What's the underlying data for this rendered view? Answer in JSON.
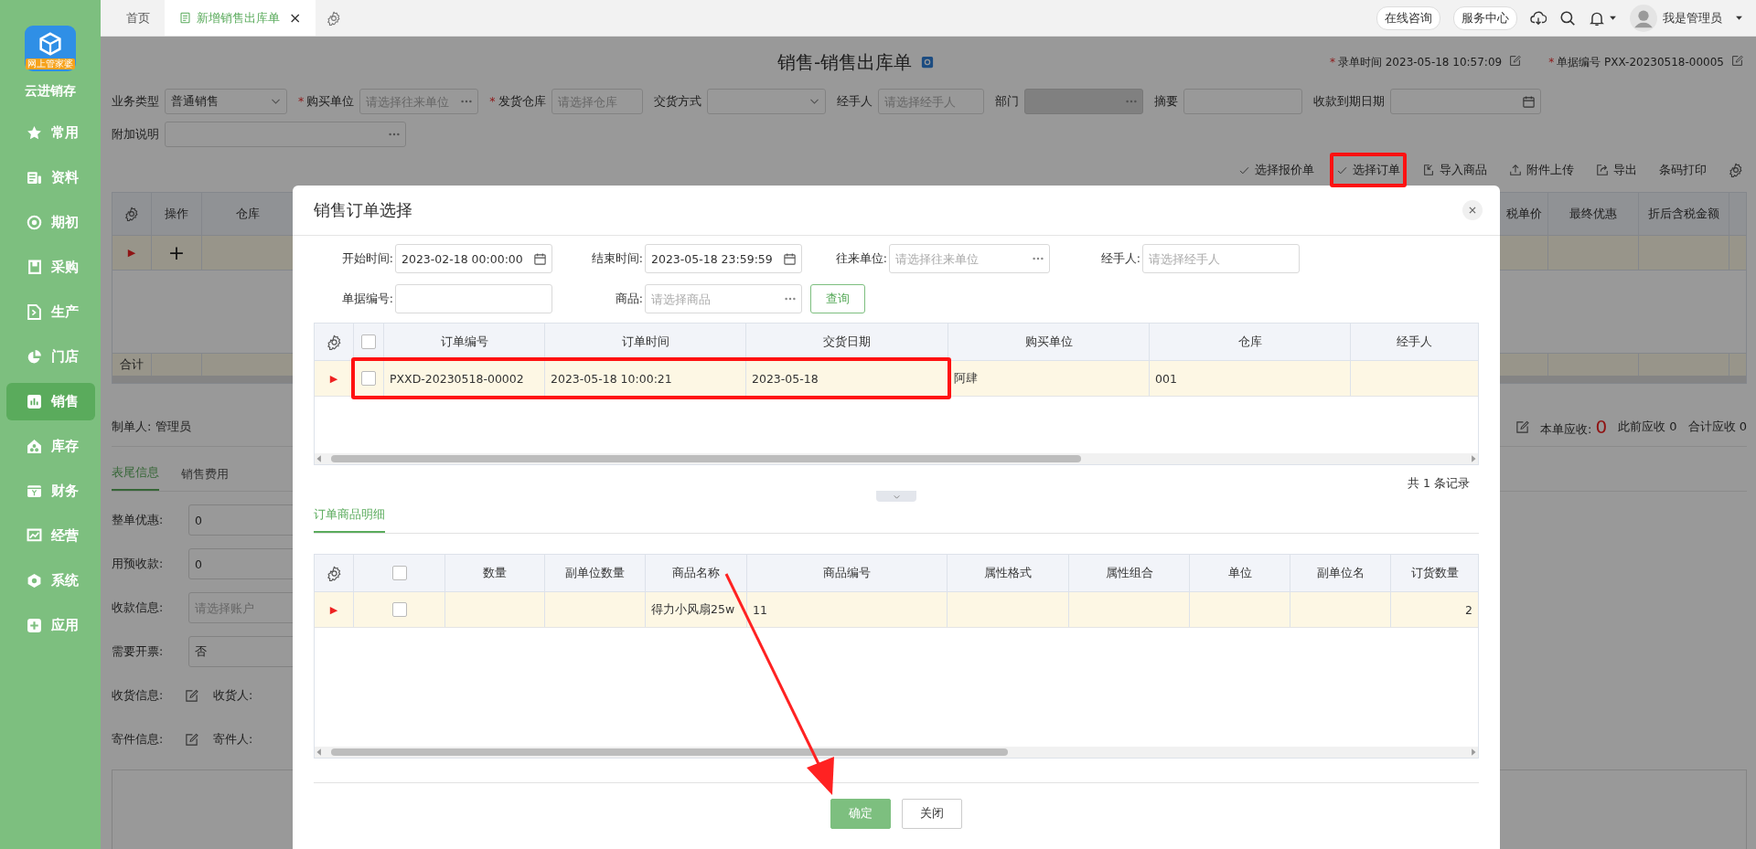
{
  "sidebar": {
    "logo_badge": "网上管家婆",
    "app_name": "云进销存",
    "items": [
      {
        "label": "常用",
        "selected": false
      },
      {
        "label": "资料",
        "selected": false
      },
      {
        "label": "期初",
        "selected": false
      },
      {
        "label": "采购",
        "selected": false
      },
      {
        "label": "生产",
        "selected": false
      },
      {
        "label": "门店",
        "selected": false
      },
      {
        "label": "销售",
        "selected": true
      },
      {
        "label": "库存",
        "selected": false
      },
      {
        "label": "财务",
        "selected": false
      },
      {
        "label": "经营",
        "selected": false
      },
      {
        "label": "系统",
        "selected": false
      },
      {
        "label": "应用",
        "selected": false
      }
    ]
  },
  "topbar": {
    "tabs": [
      {
        "label": "首页",
        "selected": false
      },
      {
        "label": "新增销售出库单",
        "selected": true,
        "close": "×"
      }
    ],
    "links": [
      "在线咨询",
      "服务中心"
    ],
    "user": "我是管理员"
  },
  "page": {
    "title": "销售-销售出库单",
    "meta": [
      {
        "mark": "*",
        "label": "录单时间",
        "value": "2023-05-18 10:57:09"
      },
      {
        "mark": "*",
        "label": "单据编号",
        "value": "PXX-20230518-00005"
      }
    ],
    "fields": [
      {
        "label": "业务类型",
        "kind": "select",
        "value": "普通销售"
      },
      {
        "mark": "*",
        "label": "购买单位",
        "kind": "picker",
        "placeholder": "请选择往来单位"
      },
      {
        "mark": "*",
        "label": "发货仓库",
        "kind": "text",
        "placeholder": "请选择仓库"
      },
      {
        "label": "交货方式",
        "kind": "select"
      },
      {
        "label": "经手人",
        "kind": "text",
        "placeholder": "请选择经手人"
      },
      {
        "label": "部门",
        "kind": "picker",
        "disabled": true
      },
      {
        "label": "摘要",
        "kind": "text"
      },
      {
        "label": "收款到期日期",
        "kind": "date"
      }
    ],
    "fields_row2": [
      {
        "label": "附加说明",
        "kind": "picker"
      }
    ],
    "toolbar": [
      {
        "label": "选择报价单",
        "highlighted": false
      },
      {
        "label": "选择订单",
        "highlighted": true
      },
      {
        "label": "导入商品",
        "highlighted": false
      },
      {
        "label": "附件上传",
        "highlighted": false
      },
      {
        "label": "导出",
        "highlighted": false
      },
      {
        "label": "条码打印",
        "highlighted": false
      }
    ],
    "grid": {
      "columns_left": [
        "操作",
        "仓库"
      ],
      "columns_right": [
        "税单价",
        "最终优惠",
        "折后含税金额"
      ],
      "rows": [
        {
          "marker": "▶",
          "action": "+"
        }
      ],
      "total_label": "合计"
    },
    "maker": {
      "label": "制单人:",
      "value": "管理员"
    },
    "receivables": [
      {
        "label": "本单应收:",
        "value": "0",
        "emphasis": true
      },
      {
        "label": "此前应收",
        "value": "0",
        "emphasis": false
      },
      {
        "label": "合计应收",
        "value": "0",
        "emphasis": false
      }
    ],
    "tabs": [
      {
        "label": "表尾信息",
        "selected": true
      },
      {
        "label": "销售费用",
        "selected": false
      }
    ],
    "footer_fields": [
      {
        "label": "整单优惠:",
        "kind": "input",
        "value": "0"
      },
      {
        "label": "用预收款:",
        "kind": "input",
        "value": "0"
      },
      {
        "label": "收款信息:",
        "kind": "input",
        "placeholder": "请选择账户"
      },
      {
        "label": "需要开票:",
        "kind": "input",
        "value": "否"
      },
      {
        "label": "收货信息:",
        "kind": "edit",
        "sublabel": "收货人:"
      },
      {
        "label": "寄件信息:",
        "kind": "edit",
        "sublabel": "寄件人:"
      }
    ]
  },
  "dialog": {
    "title": "销售订单选择",
    "filters": [
      {
        "label": "开始时间:",
        "kind": "date",
        "value": "2023-02-18 00:00:00"
      },
      {
        "label": "结束时间:",
        "kind": "date",
        "value": "2023-05-18 23:59:59"
      },
      {
        "label": "往来单位:",
        "kind": "picker",
        "placeholder": "请选择往来单位"
      },
      {
        "label": "经手人:",
        "kind": "text",
        "placeholder": "请选择经手人"
      },
      {
        "label": "单据编号:",
        "kind": "text"
      },
      {
        "label": "商品:",
        "kind": "picker",
        "placeholder": "请选择商品"
      }
    ],
    "query_button": "查询",
    "orders": {
      "all_selected": false,
      "columns": [
        "订单编号",
        "订单时间",
        "交货日期",
        "购买单位",
        "仓库",
        "经手人"
      ],
      "rows": [
        {
          "marker": "▶",
          "selected": false,
          "highlighted": true,
          "cells": [
            "PXXD-20230518-00002",
            "2023-05-18 10:00:21",
            "2023-05-18",
            "阿肆",
            "001",
            ""
          ]
        }
      ],
      "total": "共 1 条记录"
    },
    "detail_tabs": [
      {
        "label": "订单商品明细",
        "selected": true
      }
    ],
    "items": {
      "all_selected": false,
      "columns": [
        "数量",
        "副单位数量",
        "商品名称",
        "商品编号",
        "属性格式",
        "属性组合",
        "单位",
        "副单位名",
        "订货数量"
      ],
      "rows": [
        {
          "marker": "▶",
          "selected": false,
          "cells": [
            "",
            "",
            "得力小风扇25w",
            "11",
            "",
            "",
            "",
            "",
            "2"
          ]
        }
      ]
    },
    "buttons": [
      {
        "label": "确定",
        "kind": "primary"
      },
      {
        "label": "关闭",
        "kind": "default"
      }
    ]
  },
  "annotations": [
    {
      "kind": "arrow"
    }
  ]
}
